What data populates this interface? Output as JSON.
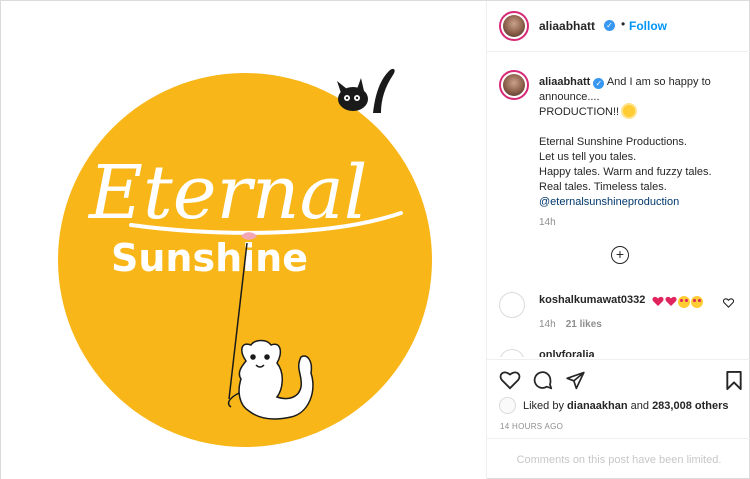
{
  "image": {
    "title_script": "Eternal",
    "title_bold": "Sunshine",
    "colors": {
      "circle": "#f8b619",
      "text": "#ffffff",
      "ink": "#1a1a1a"
    }
  },
  "header": {
    "username": "aliaabhatt",
    "separator": "•",
    "follow_label": "Follow"
  },
  "caption": {
    "username": "aliaabhatt",
    "lines": [
      "And I am so happy to announce....",
      "PRODUCTION!!",
      "Eternal Sunshine Productions.",
      "Let us tell you tales.",
      "Happy tales. Warm and fuzzy tales.",
      "Real tales. Timeless tales.",
      "@eternalsunshineproduction"
    ],
    "time": "14h"
  },
  "load_more_icon": "plus-circle-icon",
  "comments": [
    {
      "username": "koshalkumawat0332",
      "time": "14h",
      "likes": "21 likes"
    },
    {
      "username": "onlyforalia"
    }
  ],
  "likes": {
    "prefix": "Liked by",
    "user": "dianaakhan",
    "middle": "and",
    "count": "283,008 others"
  },
  "timestamp": "14 HOURS AGO",
  "comments_limited": "Comments on this post have been limited.",
  "icons": [
    "heart-icon",
    "comment-icon",
    "share-icon",
    "bookmark-icon"
  ]
}
